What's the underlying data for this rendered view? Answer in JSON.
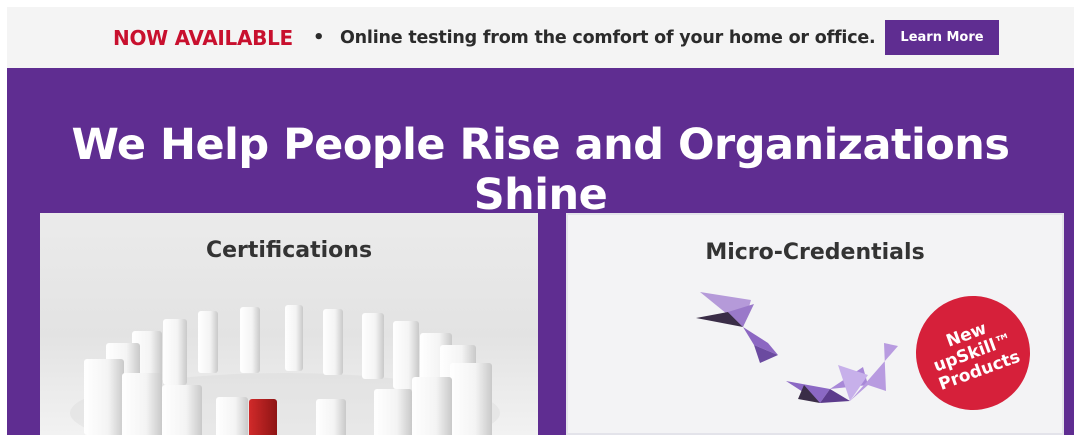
{
  "announcement": {
    "status": "NOW AVAILABLE",
    "separator": "•",
    "message": "Online testing from the comfort of your home or office.",
    "button_label": "Learn More"
  },
  "hero": {
    "title": "We Help People Rise and Organizations Shine"
  },
  "cards": [
    {
      "title": "Certifications",
      "image": "domino-circle-image"
    },
    {
      "title": "Micro-Credentials",
      "image": "origami-birds-image",
      "badge": {
        "line1": "New",
        "line2": "upSkill™",
        "line3": "Products"
      }
    }
  ],
  "colors": {
    "brand_purple": "#5f2d91",
    "alert_red": "#c8102e",
    "badge_red": "#d6203a",
    "announce_bg": "#f4f4f4"
  }
}
